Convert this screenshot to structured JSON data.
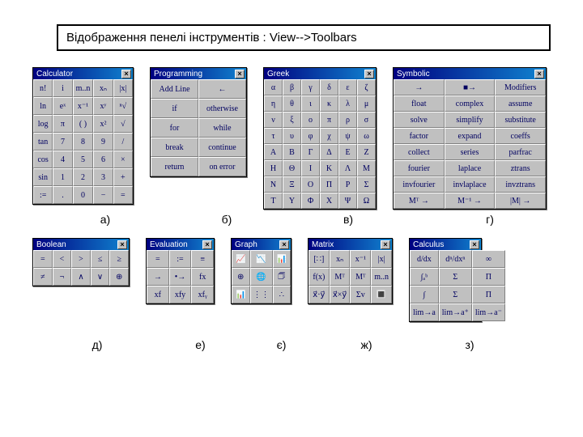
{
  "title": "Відображення пенелі інструментів : View-->Toolbars",
  "captions_top": [
    "а)",
    "б)",
    "в)",
    "г)"
  ],
  "captions_bottom": [
    "д)",
    "е)",
    "є)",
    "ж)",
    "з)"
  ],
  "palettes": {
    "calculator": {
      "title": "Calculator",
      "rows": [
        [
          "n!",
          "i",
          "m..n",
          "xₙ",
          "|x|"
        ],
        [
          "ln",
          "eˣ",
          "x⁻¹",
          "xʸ",
          "ⁿ√"
        ],
        [
          "log",
          "π",
          "( )",
          "x²",
          "√"
        ],
        [
          "tan",
          "7",
          "8",
          "9",
          "/"
        ],
        [
          "cos",
          "4",
          "5",
          "6",
          "×"
        ],
        [
          "sin",
          "1",
          "2",
          "3",
          "+"
        ],
        [
          ":=",
          ".",
          "0",
          "−",
          "="
        ]
      ]
    },
    "programming": {
      "title": "Programming",
      "rows": [
        [
          "Add Line",
          "←"
        ],
        [
          "if",
          "otherwise"
        ],
        [
          "for",
          "while"
        ],
        [
          "break",
          "continue"
        ],
        [
          "return",
          "on error"
        ]
      ]
    },
    "greek": {
      "title": "Greek",
      "rows": [
        [
          "α",
          "β",
          "γ",
          "δ",
          "ε",
          "ζ"
        ],
        [
          "η",
          "θ",
          "ι",
          "κ",
          "λ",
          "μ"
        ],
        [
          "ν",
          "ξ",
          "ο",
          "π",
          "ρ",
          "σ"
        ],
        [
          "τ",
          "υ",
          "φ",
          "χ",
          "ψ",
          "ω"
        ],
        [
          "Α",
          "Β",
          "Γ",
          "Δ",
          "Ε",
          "Ζ"
        ],
        [
          "Η",
          "Θ",
          "Ι",
          "Κ",
          "Λ",
          "Μ"
        ],
        [
          "Ν",
          "Ξ",
          "Ο",
          "Π",
          "Ρ",
          "Σ"
        ],
        [
          "Τ",
          "Υ",
          "Φ",
          "Χ",
          "Ψ",
          "Ω"
        ]
      ]
    },
    "symbolic": {
      "title": "Symbolic",
      "rows": [
        [
          "→",
          "■→",
          "Modifiers"
        ],
        [
          "float",
          "complex",
          "assume"
        ],
        [
          "solve",
          "simplify",
          "substitute"
        ],
        [
          "factor",
          "expand",
          "coeffs"
        ],
        [
          "collect",
          "series",
          "parfrac"
        ],
        [
          "fourier",
          "laplace",
          "ztrans"
        ],
        [
          "invfourier",
          "invlaplace",
          "invztrans"
        ],
        [
          "Mᵀ →",
          "M⁻¹ →",
          "|M| →"
        ]
      ]
    },
    "boolean": {
      "title": "Boolean",
      "rows": [
        [
          "=",
          "<",
          ">",
          "≤",
          "≥"
        ],
        [
          "≠",
          "¬",
          "∧",
          "∨",
          "⊕"
        ]
      ]
    },
    "evaluation": {
      "title": "Evaluation",
      "rows": [
        [
          "=",
          ":=",
          "≡"
        ],
        [
          "→",
          "•→",
          "fx"
        ],
        [
          "xf",
          "xfy",
          "xfᵧ"
        ]
      ]
    },
    "graph": {
      "title": "Graph",
      "rows": [
        [
          "📈",
          "📉",
          "📊"
        ],
        [
          "⊕",
          "🌐",
          "🗇"
        ],
        [
          "📊",
          "⋮⋮",
          "∴"
        ]
      ]
    },
    "matrix": {
      "title": "Matrix",
      "rows": [
        [
          "[∷]",
          "xₙ",
          "x⁻¹",
          "|x|"
        ],
        [
          "f(x)",
          "Mᵀ",
          "Mᵀ",
          "m..n"
        ],
        [
          "x⃗·y⃗",
          "x⃗×y⃗",
          "Σv",
          "🔳"
        ]
      ]
    },
    "calculus": {
      "title": "Calculus",
      "rows": [
        [
          "d/dx",
          "dⁿ/dxⁿ",
          "∞"
        ],
        [
          "∫ₐᵇ",
          "Σ",
          "Π"
        ],
        [
          "∫",
          "Σ",
          "Π"
        ],
        [
          "lim→a",
          "lim→a⁺",
          "lim→a⁻"
        ]
      ]
    }
  }
}
